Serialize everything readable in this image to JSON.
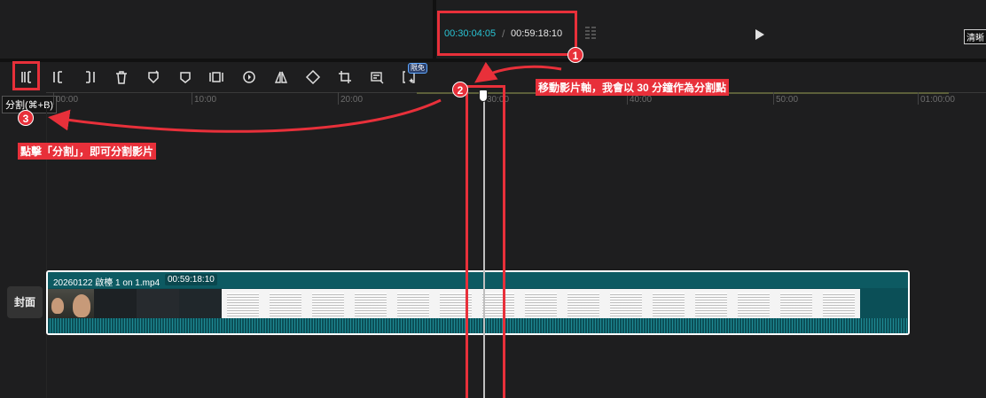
{
  "preview": {
    "current_time": "00:30:04:05",
    "separator": "/",
    "total_time": "00:59:18:10",
    "quality_label": "清晰"
  },
  "toolbar": {
    "tools": [
      "split",
      "split-left",
      "split-right",
      "delete",
      "freeze",
      "mark",
      "crop-ratio",
      "play-reverse",
      "mirror",
      "rotate",
      "crop",
      "auto-caption",
      "smart-cut"
    ],
    "free_badge": "限免",
    "tooltip": "分割(⌘+B)"
  },
  "ruler": {
    "labels": [
      "00:00",
      "10:00",
      "20:00",
      "30:00",
      "40:00",
      "50:00",
      "01:00:00"
    ]
  },
  "track": {
    "cover_label": "封面",
    "clip_name": "20260122 啟檯 1 on 1.mp4",
    "clip_duration": "00:59:18:10"
  },
  "annotations": {
    "step1_num": "1",
    "step1_text": "移動影片軸，我會以 30 分鐘作為分割點",
    "step2_num": "2",
    "step3_num": "3",
    "step3_text": "點擊「分割」，即可分割影片"
  },
  "colors": {
    "accent_time": "#29c4d4",
    "annotation_red": "#e8303a",
    "clip_teal": "#0b4f57"
  }
}
